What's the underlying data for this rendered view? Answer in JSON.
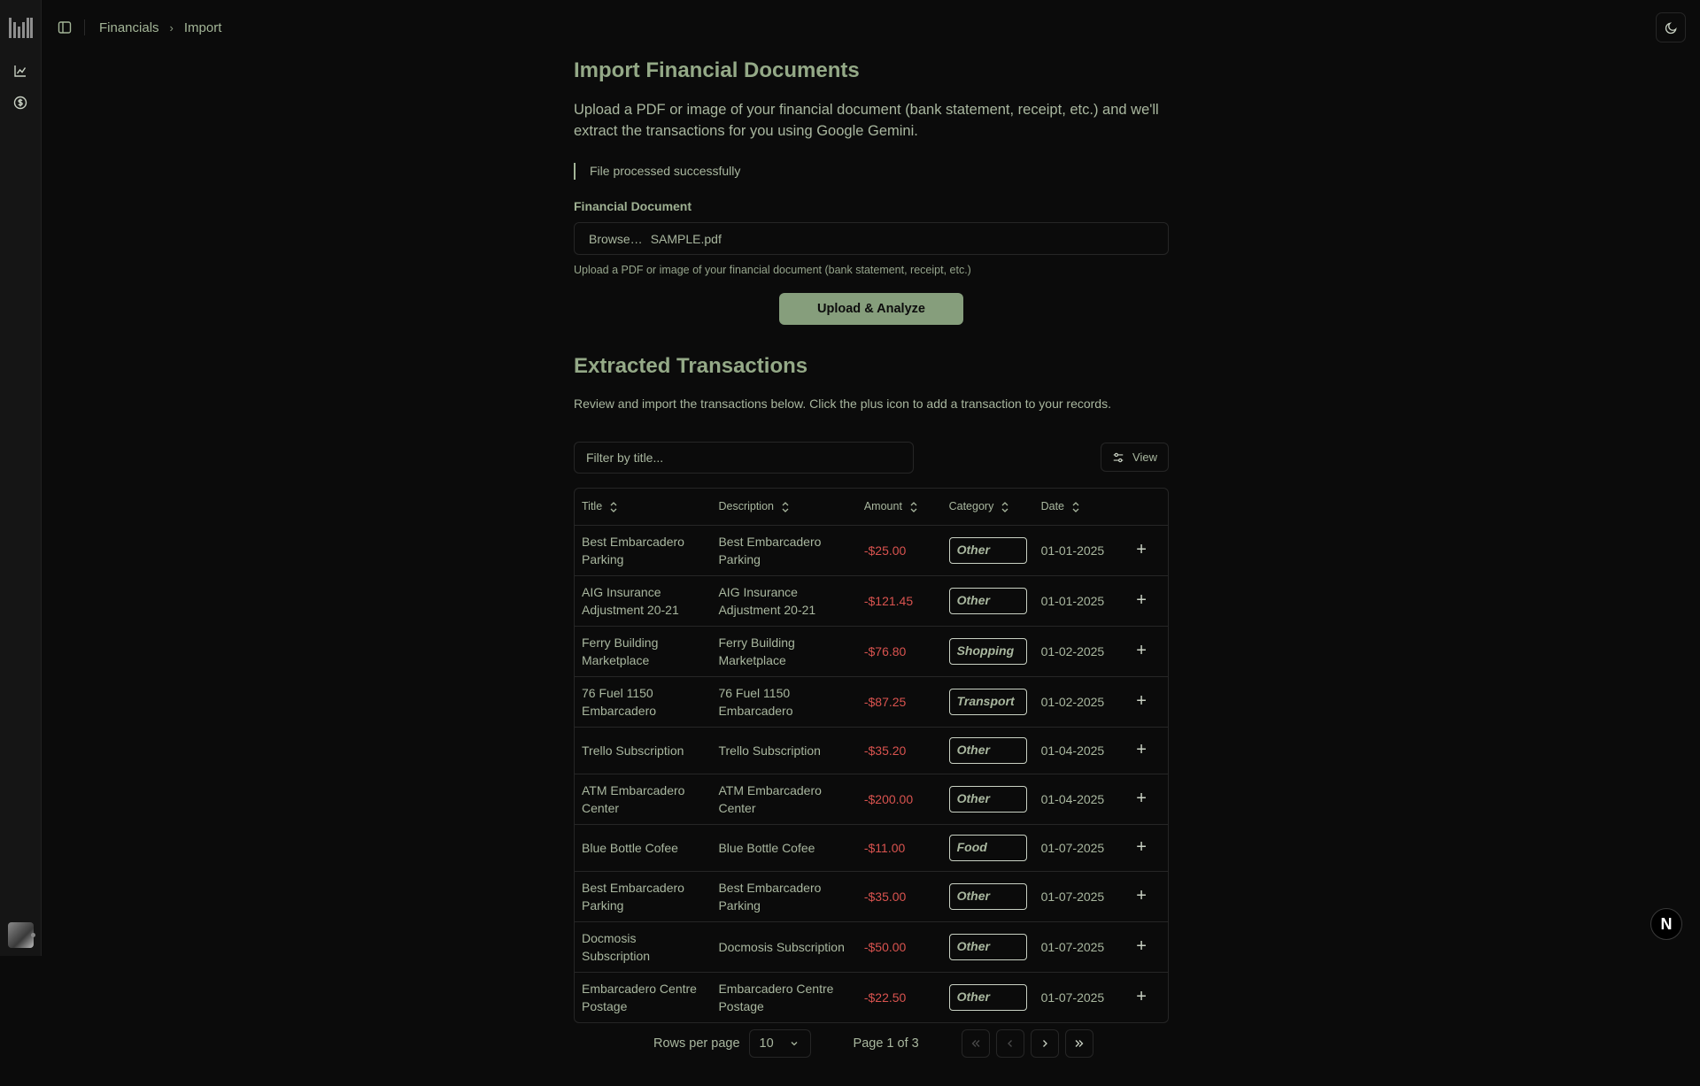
{
  "breadcrumb": {
    "parent": "Financials",
    "current": "Import"
  },
  "page": {
    "title": "Import Financial Documents",
    "intro": "Upload a PDF or image of your financial document (bank statement, receipt, etc.) and we'll extract the transactions for you using Google Gemini.",
    "success_message": "File processed successfully"
  },
  "form": {
    "label": "Financial Document",
    "browse_label": "Browse…",
    "file_name": "SAMPLE.pdf",
    "hint": "Upload a PDF or image of your financial document (bank statement, receipt, etc.)",
    "submit_label": "Upload & Analyze"
  },
  "transactions": {
    "title": "Extracted Transactions",
    "description": "Review and import the transactions below. Click the plus icon to add a transaction to your records.",
    "filter_placeholder": "Filter by title...",
    "view_label": "View",
    "columns": {
      "title": "Title",
      "description": "Description",
      "amount": "Amount",
      "category": "Category",
      "date": "Date"
    },
    "rows": [
      {
        "title": "Best Embarcadero Parking",
        "description": "Best Embarcadero Parking",
        "amount": "-$25.00",
        "category": "Other",
        "date": "01-01-2025"
      },
      {
        "title": "AIG Insurance Adjustment 20-21",
        "description": "AIG Insurance Adjustment 20-21",
        "amount": "-$121.45",
        "category": "Other",
        "date": "01-01-2025"
      },
      {
        "title": "Ferry Building Marketplace",
        "description": "Ferry Building Marketplace",
        "amount": "-$76.80",
        "category": "Shopping",
        "date": "01-02-2025"
      },
      {
        "title": "76 Fuel 1150 Embarcadero",
        "description": "76 Fuel 1150 Embarcadero",
        "amount": "-$87.25",
        "category": "Transport",
        "date": "01-02-2025"
      },
      {
        "title": "Trello Subscription",
        "description": "Trello Subscription",
        "amount": "-$35.20",
        "category": "Other",
        "date": "01-04-2025"
      },
      {
        "title": "ATM Embarcadero Center",
        "description": "ATM Embarcadero Center",
        "amount": "-$200.00",
        "category": "Other",
        "date": "01-04-2025"
      },
      {
        "title": "Blue Bottle Cofee",
        "description": "Blue Bottle Cofee",
        "amount": "-$11.00",
        "category": "Food",
        "date": "01-07-2025"
      },
      {
        "title": "Best Embarcadero Parking",
        "description": "Best Embarcadero Parking",
        "amount": "-$35.00",
        "category": "Other",
        "date": "01-07-2025"
      },
      {
        "title": "Docmosis Subscription",
        "description": "Docmosis Subscription",
        "amount": "-$50.00",
        "category": "Other",
        "date": "01-07-2025"
      },
      {
        "title": "Embarcadero Centre Postage",
        "description": "Embarcadero Centre Postage",
        "amount": "-$22.50",
        "category": "Other",
        "date": "01-07-2025"
      }
    ]
  },
  "pagination": {
    "rows_per_page_label": "Rows per page",
    "rows_per_page": "10",
    "page_info": "Page 1 of 3"
  },
  "badge": "N",
  "colors": {
    "accent": "#869e7c",
    "text": "#a9b79f",
    "negative": "#d9534f",
    "background": "#0b0b0b"
  }
}
